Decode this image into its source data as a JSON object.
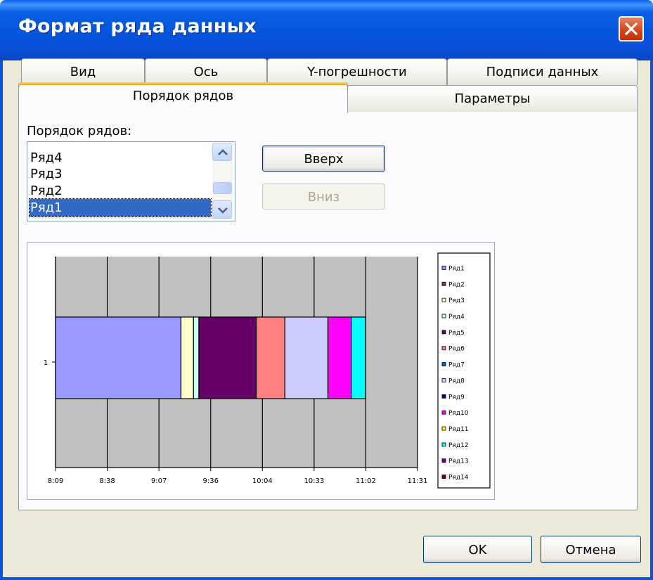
{
  "window": {
    "title": "Формат ряда данных"
  },
  "tabs": {
    "row1": [
      "Вид",
      "Ось",
      "Y-погрешности",
      "Подписи данных"
    ],
    "row2": [
      "Порядок рядов",
      "Параметры"
    ],
    "active": "Порядок рядов"
  },
  "order_panel": {
    "label": "Порядок рядов:",
    "items": [
      "Ряд4",
      "Ряд3",
      "Ряд2",
      "Ряд1"
    ],
    "selected": "Ряд1",
    "up_button": "Вверх",
    "down_button": "Вниз"
  },
  "chart_data": {
    "type": "bar",
    "orientation": "horizontal stacked",
    "categories": [
      "1"
    ],
    "x_ticks": [
      "8:09",
      "8:38",
      "9:07",
      "9:36",
      "10:04",
      "10:33",
      "11:02",
      "11:31"
    ],
    "xlim": [
      "8:09",
      "11:31"
    ],
    "plot_background": "#c0c0c0",
    "grid": true,
    "bar_start": "8:09",
    "segments": [
      {
        "end": "9:19",
        "color": "#9999ff"
      },
      {
        "end": "9:26",
        "color": "#ffffcc"
      },
      {
        "end": "9:29",
        "color": "#ccffff"
      },
      {
        "end": "9:61",
        "color": "#660066"
      },
      {
        "end": "10:17",
        "color": "#ff8080"
      },
      {
        "end": "10:41",
        "color": "#ccccff"
      },
      {
        "end": "10:54",
        "color": "#ff00ff"
      },
      {
        "end": "11:02",
        "color": "#00ffff"
      }
    ],
    "legend": {
      "position": "right",
      "entries": [
        {
          "name": "Ряд1",
          "color": "#9999ff"
        },
        {
          "name": "Ряд2",
          "color": "#993366"
        },
        {
          "name": "Ряд3",
          "color": "#ffffcc"
        },
        {
          "name": "Ряд4",
          "color": "#ccffff"
        },
        {
          "name": "Ряд5",
          "color": "#660066"
        },
        {
          "name": "Ряд6",
          "color": "#ff8080"
        },
        {
          "name": "Ряд7",
          "color": "#0066cc"
        },
        {
          "name": "Ряд8",
          "color": "#ccccff"
        },
        {
          "name": "Ряд9",
          "color": "#000080"
        },
        {
          "name": "Ряд10",
          "color": "#ff00ff"
        },
        {
          "name": "Ряд11",
          "color": "#ffff00"
        },
        {
          "name": "Ряд12",
          "color": "#00ffff"
        },
        {
          "name": "Ряд13",
          "color": "#800080"
        },
        {
          "name": "Ряд14",
          "color": "#800000"
        }
      ]
    }
  },
  "footer": {
    "ok": "OK",
    "cancel": "Отмена"
  }
}
